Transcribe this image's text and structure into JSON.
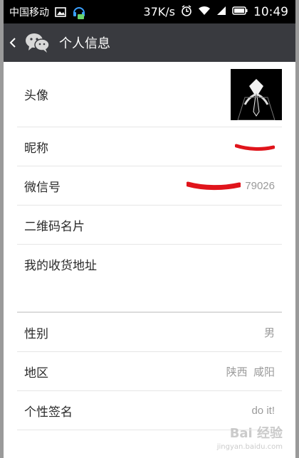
{
  "status_bar": {
    "carrier": "中国移动",
    "speed": "37K/s",
    "time": "10:49",
    "icons": [
      "image-icon",
      "headset-icon",
      "alarm-icon",
      "wifi-icon",
      "signal-icon",
      "battery-icon"
    ]
  },
  "title_bar": {
    "title": "个人信息",
    "icons": [
      "back-icon",
      "wechat-logo-icon"
    ],
    "bg_color": "#393a3f"
  },
  "profile": {
    "avatar_label": "头像",
    "nickname_label": "昵称",
    "nickname_value": "",
    "wechat_id_label": "微信号",
    "wechat_id_value": "79026",
    "qrcode_label": "二维码名片",
    "address_label": "我的收货地址",
    "gender_label": "性别",
    "gender_value": "男",
    "region_label": "地区",
    "region_value": "陕西  咸阳",
    "signature_label": "个性签名",
    "signature_value": "do it!"
  },
  "watermark": {
    "main": "Bai 经验",
    "sub": "jingyan.baidu.com"
  },
  "colors": {
    "redaction": "#e0141b",
    "value_text": "#9a9a9a"
  }
}
